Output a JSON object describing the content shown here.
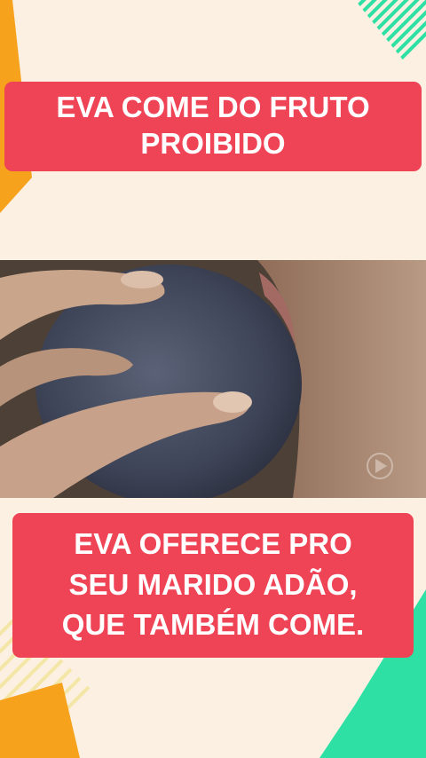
{
  "top_caption": {
    "line1": "EVA COME DO FRUTO",
    "line2": "PROIBIDO"
  },
  "bottom_caption": {
    "line1": "EVA OFERECE PRO",
    "line2": "SEU MARIDO ADÃO,",
    "line3": "QUE TAMBÉM COME."
  },
  "video": {
    "subject": "hand-holding-dark-fruit-to-mouth"
  },
  "colors": {
    "background": "#fbf0e2",
    "caption_bg": "#ef4356",
    "caption_text": "#ffffff",
    "accent_orange": "#f6a21c",
    "accent_green": "#2fe0a4"
  }
}
